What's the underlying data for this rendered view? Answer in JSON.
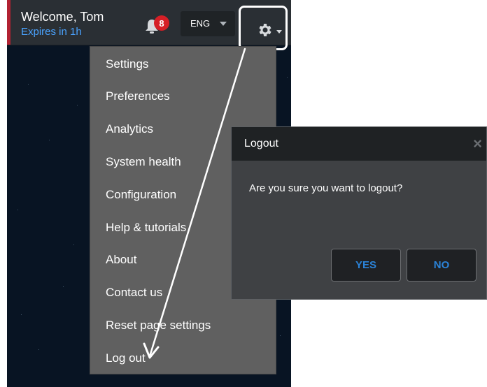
{
  "header": {
    "welcome": "Welcome, Tom",
    "expires": "Expires in 1h",
    "notifications_count": "8",
    "language": "ENG",
    "settings_icon": "gear-icon",
    "notifications_icon": "bell-icon"
  },
  "menu": {
    "items": [
      {
        "label": "Settings"
      },
      {
        "label": "Preferences"
      },
      {
        "label": "Analytics"
      },
      {
        "label": "System health"
      },
      {
        "label": "Configuration"
      },
      {
        "label": "Help & tutorials"
      },
      {
        "label": "About"
      },
      {
        "label": "Contact us"
      },
      {
        "label": "Reset page settings"
      },
      {
        "label": "Log out"
      }
    ]
  },
  "dialog": {
    "title": "Logout",
    "close": "×",
    "message": "Are you sure you want to logout?",
    "yes_label": "YES",
    "no_label": "NO"
  },
  "colors": {
    "accent_blue": "#2b83d8",
    "badge_red": "#d61f26",
    "brand_red": "#b22232"
  }
}
